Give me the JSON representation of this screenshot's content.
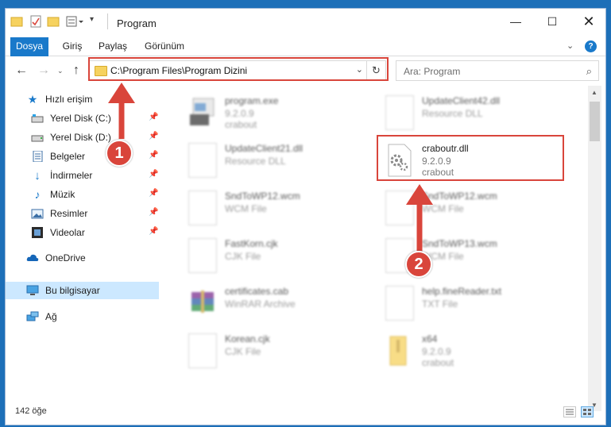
{
  "window": {
    "title": "Program"
  },
  "ribbon": {
    "tabs": [
      "Dosya",
      "Giriş",
      "Paylaş",
      "Görünüm"
    ]
  },
  "address": {
    "path": "C:\\Program Files\\Program Dizini"
  },
  "search": {
    "placeholder": "Ara: Program"
  },
  "sidebar": {
    "quick_access": "Hızlı erişim",
    "items": [
      {
        "label": "Yerel Disk (C:)",
        "icon": "drive-icon"
      },
      {
        "label": "Yerel Disk (D:)",
        "icon": "drive-icon"
      },
      {
        "label": "Belgeler",
        "icon": "documents-icon"
      },
      {
        "label": "İndirmeler",
        "icon": "download-icon"
      },
      {
        "label": "Müzik",
        "icon": "music-icon"
      },
      {
        "label": "Resimler",
        "icon": "pictures-icon"
      },
      {
        "label": "Videolar",
        "icon": "video-icon"
      }
    ],
    "onedrive": "OneDrive",
    "this_pc": "Bu bilgisayar",
    "network": "Ağ"
  },
  "files": [
    {
      "name": "program.exe",
      "sub": "9.2.0.9",
      "sub2": "crabout"
    },
    {
      "name": "UpdateClient42.dll",
      "sub": "Resource DLL",
      "sub2": ""
    },
    {
      "name": "UpdateClient21.dll",
      "sub": "Resource DLL",
      "sub2": ""
    },
    {
      "name": "craboutr.dll",
      "sub": "9.2.0.9",
      "sub2": "crabout"
    },
    {
      "name": "SndToWP12.wcm",
      "sub": "WCM File",
      "sub2": ""
    },
    {
      "name": "SndToWP12.wcm",
      "sub": "WCM File",
      "sub2": ""
    },
    {
      "name": "FastKorn.cjk",
      "sub": "CJK File",
      "sub2": ""
    },
    {
      "name": "SndToWP13.wcm",
      "sub": "WCM File",
      "sub2": ""
    },
    {
      "name": "certificates.cab",
      "sub": "WinRAR Archive",
      "sub2": ""
    },
    {
      "name": "help.fineReader.txt",
      "sub": "TXT File",
      "sub2": ""
    },
    {
      "name": "Korean.cjk",
      "sub": "CJK File",
      "sub2": ""
    },
    {
      "name": "x64",
      "sub": "9.2.0.9",
      "sub2": "crabout"
    }
  ],
  "status": {
    "count": "142 öğe"
  },
  "callouts": {
    "one": "1",
    "two": "2"
  },
  "colors": {
    "accent": "#1979ca",
    "highlight": "#d9453b",
    "selection": "#cce8ff"
  }
}
